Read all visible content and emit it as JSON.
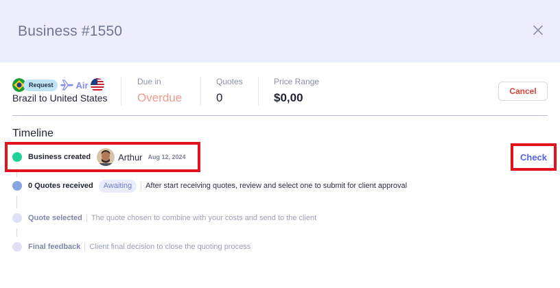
{
  "header": {
    "title": "Business #1550"
  },
  "summary": {
    "request_badge": "Request",
    "mode_label": "Air",
    "route": "Brazil to United States",
    "due": {
      "label": "Due in",
      "value": "Overdue"
    },
    "quotes": {
      "label": "Quotes",
      "value": "0"
    },
    "price": {
      "label": "Price Range",
      "value": "$0,00"
    },
    "cancel_label": "Cancel"
  },
  "timeline": {
    "title": "Timeline",
    "items": [
      {
        "label": "Business created",
        "user": "Arthur",
        "date": "Aug 12, 2024",
        "action": "Check",
        "status": "done"
      },
      {
        "label": "0 Quotes received",
        "badge": "Awaiting",
        "description": "After start receiving quotes, review and select one to submit for client approval",
        "status": "current"
      },
      {
        "label": "Quote selected",
        "description": "The quote chosen to combine with your costs and send to the client",
        "status": "pending"
      },
      {
        "label": "Final feedback",
        "description": "Client final decision to close the quoting process",
        "status": "pending"
      }
    ]
  },
  "colors": {
    "header_bg": "#eceefb",
    "accent": "#5a63e6",
    "overdue": "#f09a8f",
    "cancel": "#d9433b",
    "highlight": "#e3131b",
    "done_dot": "#1fd29a"
  },
  "icons": [
    "close-icon",
    "brazil-flag-icon",
    "plane-icon",
    "usa-flag-icon",
    "user-avatar"
  ]
}
